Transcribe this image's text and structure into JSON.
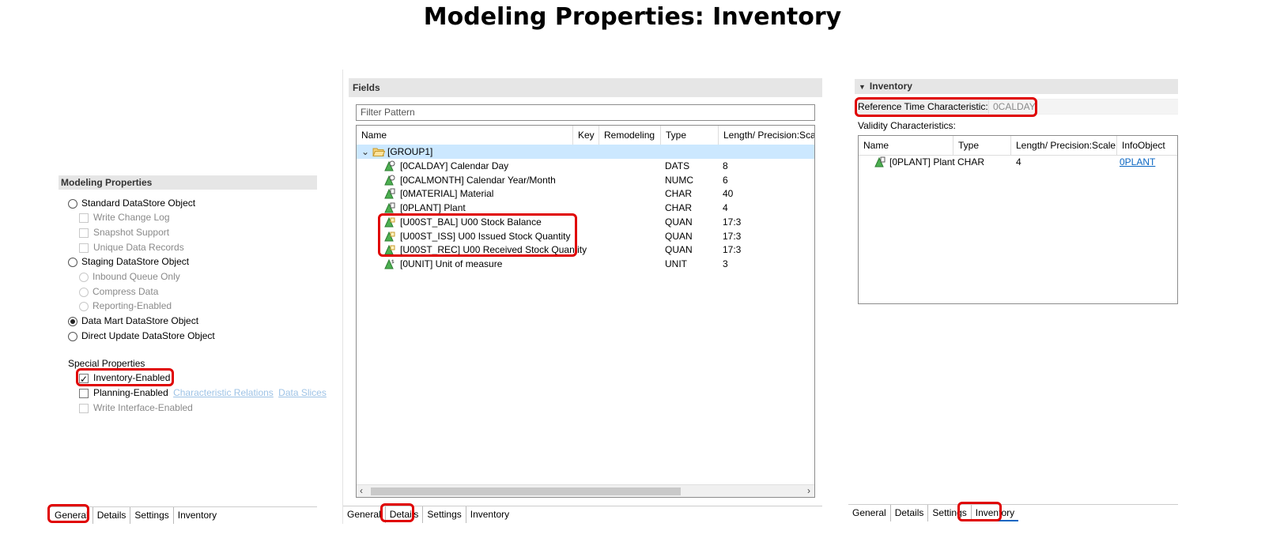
{
  "title": "Modeling Properties: Inventory",
  "left_panel": {
    "header": "Modeling Properties",
    "options": [
      {
        "label": "Standard DataStore Object",
        "kind": "radio",
        "checked": false,
        "disabled": false
      },
      {
        "label": "Write Change Log",
        "kind": "checkbox",
        "checked": false,
        "disabled": true
      },
      {
        "label": "Snapshot Support",
        "kind": "checkbox",
        "checked": false,
        "disabled": true
      },
      {
        "label": "Unique Data Records",
        "kind": "checkbox",
        "checked": false,
        "disabled": true
      },
      {
        "label": "Staging DataStore Object",
        "kind": "radio",
        "checked": false,
        "disabled": false
      },
      {
        "label": "Inbound Queue Only",
        "kind": "radio",
        "checked": false,
        "disabled": true
      },
      {
        "label": "Compress Data",
        "kind": "radio",
        "checked": false,
        "disabled": true
      },
      {
        "label": "Reporting-Enabled",
        "kind": "radio",
        "checked": false,
        "disabled": true
      },
      {
        "label": "Data Mart DataStore Object",
        "kind": "radio",
        "checked": true,
        "disabled": false
      },
      {
        "label": "Direct Update DataStore Object",
        "kind": "radio",
        "checked": false,
        "disabled": false
      }
    ],
    "special_header": "Special Properties",
    "inventory_enabled": "Inventory-Enabled",
    "planning_enabled": "Planning-Enabled",
    "char_relations": "Characteristic Relations",
    "data_slices": "Data Slices",
    "write_interface": "Write Interface-Enabled",
    "tabs": [
      "General",
      "Details",
      "Settings",
      "Inventory"
    ]
  },
  "middle_panel": {
    "header": "Fields",
    "filter_placeholder": "Filter Pattern",
    "columns": [
      "Name",
      "Key",
      "Remodeling",
      "Type",
      "Length/ Precision:Scal"
    ],
    "group": "[GROUP1]",
    "rows": [
      {
        "name": "[0CALDAY] Calendar Day",
        "type": "DATS",
        "length": "8",
        "icon": "time-char-icon"
      },
      {
        "name": "[0CALMONTH] Calendar Year/Month",
        "type": "NUMC",
        "length": "6",
        "icon": "time-char-icon"
      },
      {
        "name": "[0MATERIAL] Material",
        "type": "CHAR",
        "length": "40",
        "icon": "char-icon"
      },
      {
        "name": "[0PLANT] Plant",
        "type": "CHAR",
        "length": "4",
        "icon": "char-icon"
      },
      {
        "name": "[U00ST_BAL] U00 Stock Balance",
        "type": "QUAN",
        "length": "17:3",
        "icon": "keyfigure-icon"
      },
      {
        "name": "[U00ST_ISS] U00 Issued Stock Quantity",
        "type": "QUAN",
        "length": "17:3",
        "icon": "keyfigure-icon"
      },
      {
        "name": "[U00ST_REC] U00 Received Stock Quantity",
        "type": "QUAN",
        "length": "17:3",
        "icon": "keyfigure-icon"
      },
      {
        "name": "[0UNIT] Unit of measure",
        "type": "UNIT",
        "length": "3",
        "icon": "unit-icon"
      }
    ],
    "tabs": [
      "General",
      "Details",
      "Settings",
      "Inventory"
    ]
  },
  "right_panel": {
    "header": "Inventory",
    "ref_time_label": "Reference Time Characteristic:",
    "ref_time_value": "0CALDAY",
    "validity_label": "Validity Characteristics:",
    "columns": [
      "Name",
      "Type",
      "Length/ Precision:Scale",
      "InfoObject"
    ],
    "rows": [
      {
        "name": "[0PLANT] Plant",
        "type": "CHAR",
        "length": "4",
        "infoobject": "0PLANT"
      }
    ],
    "tabs": [
      "General",
      "Details",
      "Settings",
      "Inventory"
    ]
  },
  "colors": {
    "highlight": "#e00000",
    "selection": "#cce8ff",
    "link": "#0a66c2"
  }
}
